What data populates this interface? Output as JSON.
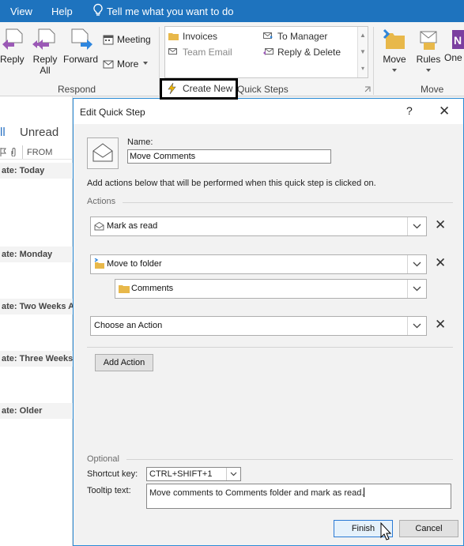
{
  "menubar": {
    "view": "View",
    "help": "Help",
    "tell_me": "Tell me what you want to do"
  },
  "ribbon": {
    "respond": {
      "group_label": "Respond",
      "reply": "Reply",
      "reply_all_1": "Reply",
      "reply_all_2": "All",
      "forward": "Forward",
      "meeting": "Meeting",
      "more": "More"
    },
    "quick_steps": {
      "group_label": "Quick Steps",
      "items": [
        "Invoices",
        "To Manager",
        "Team Email",
        "Reply & Delete"
      ],
      "create_new": "Create New"
    },
    "move": {
      "group_label": "Move",
      "move": "Move",
      "rules": "Rules",
      "onenote": "One"
    }
  },
  "mail_list": {
    "tab_all": "ll",
    "tab_unread": "Unread",
    "col_from": "FROM",
    "date_groups": [
      "ate: Today",
      "ate: Monday",
      "ate: Two Weeks A",
      "ate: Three Weeks A",
      "ate: Older"
    ]
  },
  "dialog": {
    "title": "Edit Quick Step",
    "help": "?",
    "close": "✕",
    "name_label": "Name:",
    "name_value": "Move Comments",
    "intro": "Add actions below that will be performed when this quick step is clicked on.",
    "actions_label": "Actions",
    "actions": [
      {
        "label": "Mark as read"
      },
      {
        "label": "Move to folder",
        "sub": "Comments"
      },
      {
        "label": "Choose an Action"
      }
    ],
    "add_action": "Add Action",
    "optional_label": "Optional",
    "shortcut_label": "Shortcut key:",
    "shortcut_value": "CTRL+SHIFT+1",
    "tooltip_label": "Tooltip text:",
    "tooltip_value": "Move comments to Comments folder and mark as read.",
    "finish": "Finish",
    "cancel": "Cancel"
  },
  "colors": {
    "accent": "#1e73be",
    "dialog_border": "#2a8bd6",
    "folder": "#e8b84a"
  }
}
